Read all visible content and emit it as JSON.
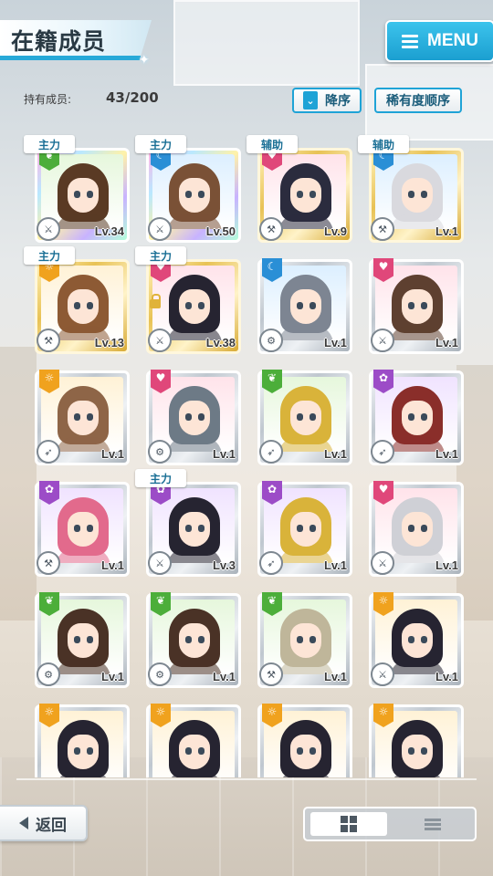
{
  "header": {
    "title": "在籍成员",
    "menu_label": "MENU",
    "menu_icon": "menu-icon"
  },
  "members": {
    "count_label": "持有成员:",
    "count_value": "43/200"
  },
  "sort": {
    "order_label": "降序",
    "order_icon": "chevron-down-icon",
    "rarity_label": "稀有度顺序"
  },
  "colors": {
    "accent": "#1fa3d6",
    "attr_sun": "#f0a21e",
    "attr_heart": "#e0477a",
    "attr_moon": "#2a8fd6",
    "attr_flower": "#9c4cc7",
    "attr_leaf": "#4cae3a"
  },
  "cards": [
    {
      "role": "主力",
      "level": "Lv.34",
      "frame": "rainbow",
      "attr": "leaf",
      "hair": "#5a3a24",
      "type": "sword-icon"
    },
    {
      "role": "主力",
      "level": "Lv.50",
      "frame": "rainbow",
      "attr": "moon",
      "hair": "#7a5136",
      "type": "sword-icon"
    },
    {
      "role": "辅助",
      "level": "Lv.9",
      "frame": "gold",
      "attr": "heart",
      "hair": "#2b2c3e",
      "type": "wrench-icon"
    },
    {
      "role": "辅助",
      "level": "Lv.1",
      "frame": "gold",
      "attr": "moon",
      "hair": "#d9d9de",
      "type": "wrench-icon"
    },
    {
      "role": "主力",
      "level": "Lv.13",
      "frame": "gold",
      "attr": "sun",
      "hair": "#8d5a34",
      "type": "hammer-icon"
    },
    {
      "role": "主力",
      "level": "Lv.38",
      "frame": "gold",
      "attr": "heart",
      "hair": "#262431",
      "type": "sword-icon",
      "locked": true
    },
    {
      "role": "",
      "level": "Lv.1",
      "frame": "silver",
      "attr": "moon",
      "hair": "#7d8592",
      "type": "gear-icon"
    },
    {
      "role": "",
      "level": "Lv.1",
      "frame": "silver",
      "attr": "heart",
      "hair": "#5e4030",
      "type": "sword-icon"
    },
    {
      "role": "",
      "level": "Lv.1",
      "frame": "silver",
      "attr": "sun",
      "hair": "#8e6547",
      "type": "rocket-icon"
    },
    {
      "role": "",
      "level": "Lv.1",
      "frame": "silver",
      "attr": "heart",
      "hair": "#6d7a86",
      "type": "gear-icon"
    },
    {
      "role": "",
      "level": "Lv.1",
      "frame": "silver",
      "attr": "leaf",
      "hair": "#d9b33a",
      "type": "rocket-icon"
    },
    {
      "role": "",
      "level": "Lv.1",
      "frame": "silver",
      "attr": "flower",
      "hair": "#8a2e2a",
      "type": "rocket-icon"
    },
    {
      "role": "",
      "level": "Lv.1",
      "frame": "silver",
      "attr": "flower",
      "hair": "#e26a8c",
      "type": "hammer-icon"
    },
    {
      "role": "主力",
      "level": "Lv.3",
      "frame": "silver",
      "attr": "flower",
      "hair": "#262431",
      "type": "sword-icon"
    },
    {
      "role": "",
      "level": "Lv.1",
      "frame": "silver",
      "attr": "flower",
      "hair": "#d9b33a",
      "type": "rocket-icon"
    },
    {
      "role": "",
      "level": "Lv.1",
      "frame": "silver",
      "attr": "heart",
      "hair": "#cfd0d6",
      "type": "sword-icon"
    },
    {
      "role": "",
      "level": "Lv.1",
      "frame": "silver",
      "attr": "leaf",
      "hair": "#4a3226",
      "type": "gear-icon"
    },
    {
      "role": "",
      "level": "Lv.1",
      "frame": "silver",
      "attr": "leaf",
      "hair": "#4a3226",
      "type": "gear-icon"
    },
    {
      "role": "",
      "level": "Lv.1",
      "frame": "silver",
      "attr": "leaf",
      "hair": "#bfb69a",
      "type": "wrench-icon"
    },
    {
      "role": "",
      "level": "Lv.1",
      "frame": "silver",
      "attr": "sun",
      "hair": "#262431",
      "type": "sword-icon"
    },
    {
      "role": "",
      "level": "",
      "frame": "silver",
      "attr": "sun",
      "hair": "#262431",
      "type": ""
    },
    {
      "role": "",
      "level": "",
      "frame": "silver",
      "attr": "sun",
      "hair": "#262431",
      "type": ""
    },
    {
      "role": "",
      "level": "",
      "frame": "silver",
      "attr": "sun",
      "hair": "#262431",
      "type": ""
    },
    {
      "role": "",
      "level": "",
      "frame": "silver",
      "attr": "sun",
      "hair": "#262431",
      "type": ""
    }
  ],
  "footer": {
    "back_label": "返回",
    "back_icon": "back-arrow-icon",
    "grid_view_icon": "grid-view-icon",
    "list_view_icon": "list-view-icon"
  }
}
